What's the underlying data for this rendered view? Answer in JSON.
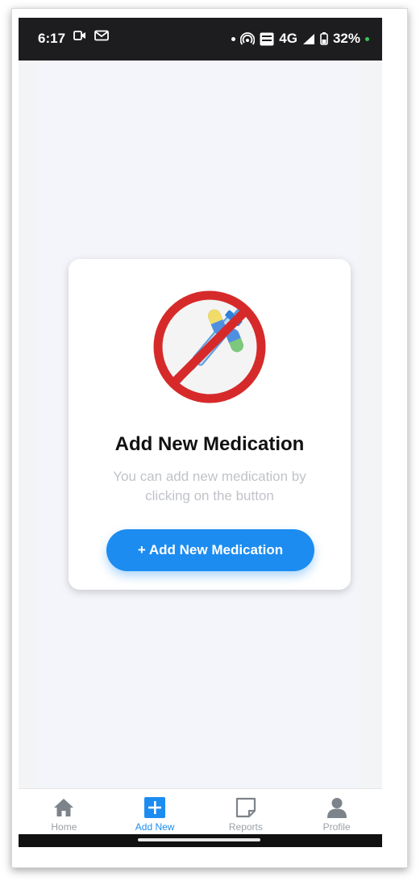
{
  "status_bar": {
    "time": "6:17",
    "network": "4G",
    "battery": "32%",
    "left_icons": [
      "video-icon",
      "gmail-icon"
    ],
    "right_icons": [
      "notification-dot",
      "hotspot-icon",
      "volte-icon",
      "signal-icon",
      "battery-icon",
      "privacy-dot"
    ]
  },
  "empty_state": {
    "illustration": "no-medication-icon",
    "title": "Add New Medication",
    "subtitle": "You can add new medication by clicking on the button",
    "button_label": "+ Add New Medication"
  },
  "bottom_nav": {
    "items": [
      {
        "label": "Home",
        "icon": "home-icon",
        "active": false
      },
      {
        "label": "Add New",
        "icon": "plus-square-icon",
        "active": true
      },
      {
        "label": "Reports",
        "icon": "note-icon",
        "active": false
      },
      {
        "label": "Profile",
        "icon": "user-icon",
        "active": false
      }
    ]
  },
  "colors": {
    "accent": "#1c8cf0",
    "forbidden_red": "#d62a2a",
    "status_bar": "#1d1d1f",
    "content_bg": "#f3f5fa"
  }
}
